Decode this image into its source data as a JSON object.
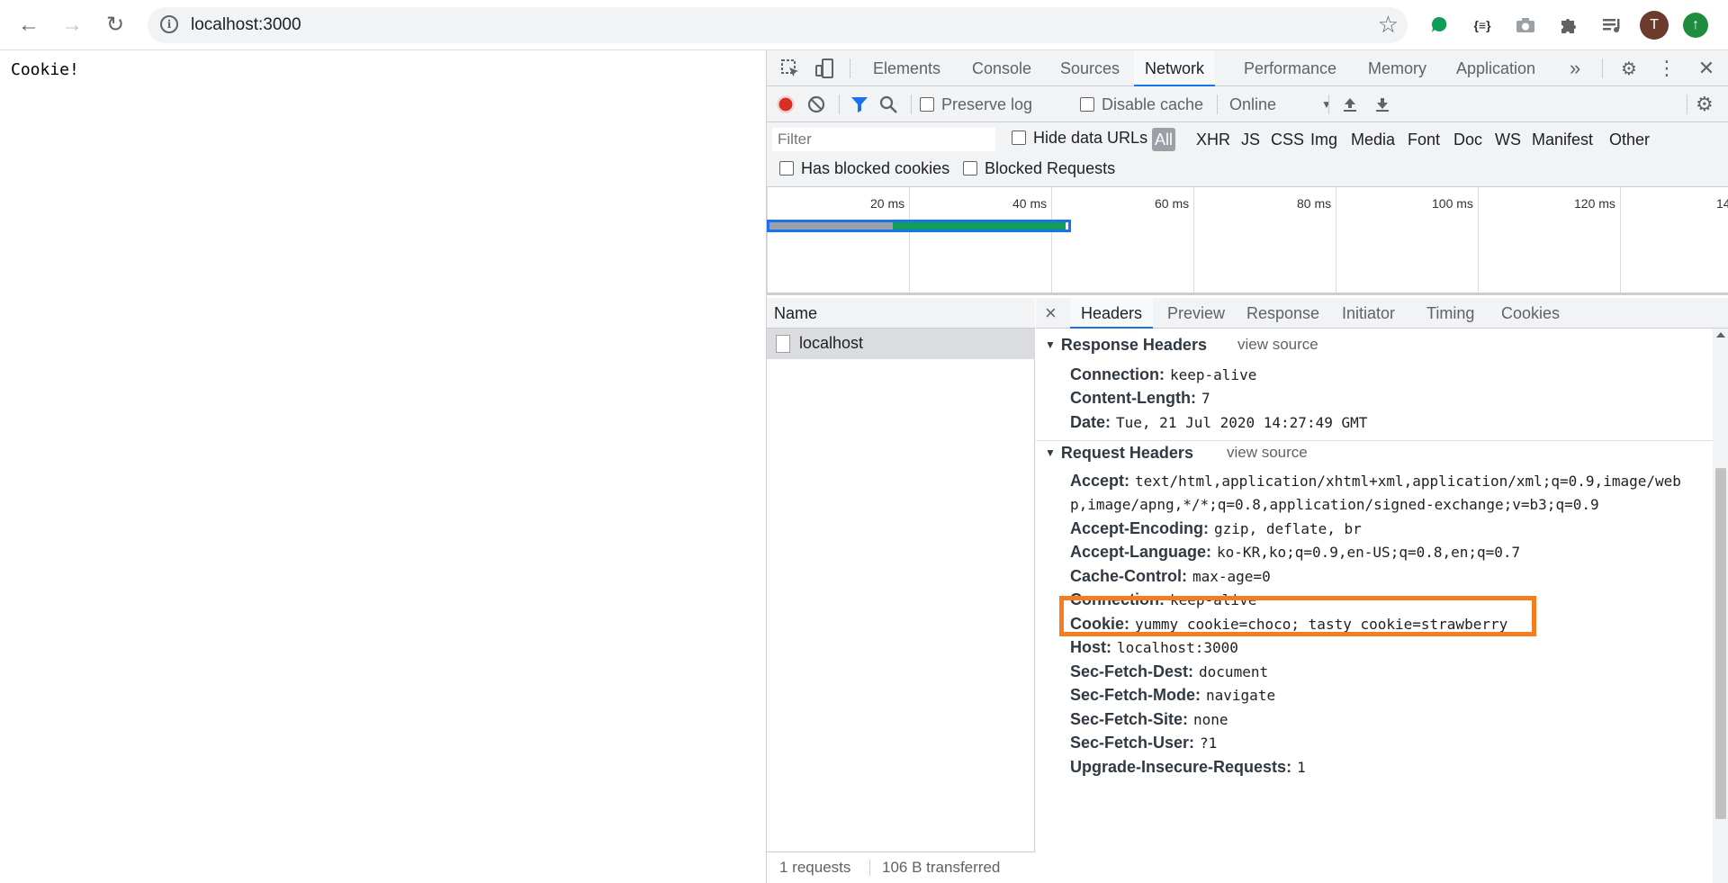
{
  "browser": {
    "url": "localhost:3000",
    "profile_initial": "T",
    "extension_json_label": "{≡}"
  },
  "page": {
    "text": "Cookie!"
  },
  "devtools": {
    "tabs": [
      "Elements",
      "Console",
      "Sources",
      "Network",
      "Performance",
      "Memory",
      "Application"
    ],
    "active_tab": "Network",
    "more_tabs": "»",
    "network_bar": {
      "preserve_log": "Preserve log",
      "disable_cache": "Disable cache",
      "throttle": "Online"
    },
    "filter": {
      "placeholder": "Filter",
      "hide_data_urls": "Hide data URLs",
      "types": [
        "All",
        "XHR",
        "JS",
        "CSS",
        "Img",
        "Media",
        "Font",
        "Doc",
        "WS",
        "Manifest",
        "Other"
      ],
      "active_type": "All",
      "has_blocked_cookies": "Has blocked cookies",
      "blocked_requests": "Blocked Requests"
    },
    "timeline": {
      "ticks": [
        "20 ms",
        "40 ms",
        "60 ms",
        "80 ms",
        "100 ms",
        "120 ms",
        "14"
      ]
    },
    "requests": {
      "column": "Name",
      "items": [
        "localhost"
      ],
      "status": [
        "1 requests",
        "106 B transferred"
      ]
    },
    "detail": {
      "close": "×",
      "tabs": [
        "Headers",
        "Preview",
        "Response",
        "Initiator",
        "Timing",
        "Cookies"
      ],
      "active_tab": "Headers",
      "response_headers": {
        "title": "Response Headers",
        "view_source": "view source",
        "rows": [
          {
            "name": "Connection:",
            "value": "keep-alive"
          },
          {
            "name": "Content-Length:",
            "value": "7"
          },
          {
            "name": "Date:",
            "value": "Tue, 21 Jul 2020 14:27:49 GMT"
          }
        ]
      },
      "request_headers": {
        "title": "Request Headers",
        "view_source": "view source",
        "accept_line1": "text/html,application/xhtml+xml,application/xml;q=0.9,image/web",
        "accept_line2": "p,image/apng,*/*;q=0.8,application/signed-exchange;v=b3;q=0.9",
        "rows": [
          {
            "name": "Accept:",
            "value": ""
          },
          {
            "name": "Accept-Encoding:",
            "value": "gzip, deflate, br"
          },
          {
            "name": "Accept-Language:",
            "value": "ko-KR,ko;q=0.9,en-US;q=0.8,en;q=0.7"
          },
          {
            "name": "Cache-Control:",
            "value": "max-age=0"
          },
          {
            "name": "Connection:",
            "value": "keep-alive"
          },
          {
            "name": "Cookie:",
            "value": "yummy_cookie=choco; tasty_cookie=strawberry"
          },
          {
            "name": "Host:",
            "value": "localhost:3000"
          },
          {
            "name": "Sec-Fetch-Dest:",
            "value": "document"
          },
          {
            "name": "Sec-Fetch-Mode:",
            "value": "navigate"
          },
          {
            "name": "Sec-Fetch-Site:",
            "value": "none"
          },
          {
            "name": "Sec-Fetch-User:",
            "value": "?1"
          },
          {
            "name": "Upgrade-Insecure-Requests:",
            "value": "1"
          }
        ]
      }
    }
  },
  "colors": {
    "highlight": "#f57c1f",
    "accent": "#1a73e8",
    "record": "#d93025"
  }
}
